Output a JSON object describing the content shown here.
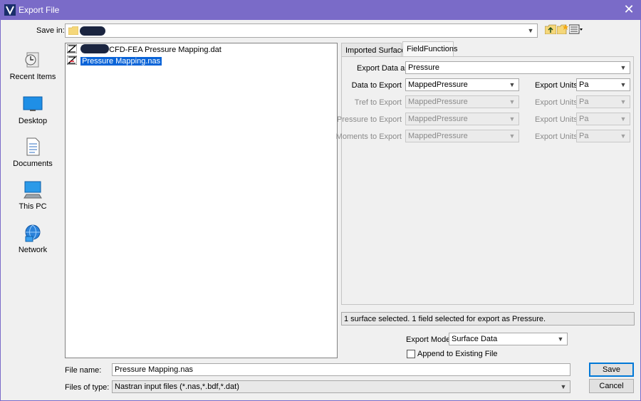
{
  "window": {
    "title": "Export File",
    "close_glyph": "✕"
  },
  "save_in": {
    "label": "Save in:",
    "value": ""
  },
  "places": [
    {
      "label": "Recent Items",
      "icon": "recent-items-icon"
    },
    {
      "label": "Desktop",
      "icon": "desktop-icon"
    },
    {
      "label": "Documents",
      "icon": "documents-icon"
    },
    {
      "label": "This PC",
      "icon": "this-pc-icon"
    },
    {
      "label": "Network",
      "icon": "network-icon"
    }
  ],
  "files": [
    {
      "name": "CFD-FEA Pressure Mapping.dat",
      "selected": false
    },
    {
      "name": "Pressure Mapping.nas",
      "selected": true
    }
  ],
  "tabs": [
    {
      "label": "Imported Surfaces"
    },
    {
      "label": "FieldFunctions"
    }
  ],
  "panel": {
    "export_data_as": {
      "label": "Export Data as",
      "value": "Pressure"
    },
    "rows": [
      {
        "label": "Data to Export",
        "value": "MappedPressure",
        "units_label": "Export Units",
        "units": "Pa",
        "enabled": true
      },
      {
        "label": "Tref to Export",
        "value": "MappedPressure",
        "units_label": "Export Units",
        "units": "Pa",
        "enabled": false
      },
      {
        "label": "Pressure to Export",
        "value": "MappedPressure",
        "units_label": "Export Units",
        "units": "Pa",
        "enabled": false
      },
      {
        "label": "Moments to Export",
        "value": "MappedPressure",
        "units_label": "Export Units",
        "units": "Pa",
        "enabled": false
      }
    ]
  },
  "status_text": "1 surface selected. 1 field selected for export as Pressure.",
  "export_mode": {
    "label": "Export Mode",
    "value": "Surface Data"
  },
  "append": {
    "label": "Append to Existing File",
    "checked": false
  },
  "file_name": {
    "label": "File name:",
    "value": "Pressure Mapping.nas"
  },
  "files_of_type": {
    "label": "Files of type:",
    "value": "Nastran input files (*.nas,*.bdf,*.dat)"
  },
  "buttons": {
    "save": "Save",
    "cancel": "Cancel"
  },
  "colors": {
    "titlebar": "#7a6bc8",
    "selection": "#0a64d8"
  }
}
